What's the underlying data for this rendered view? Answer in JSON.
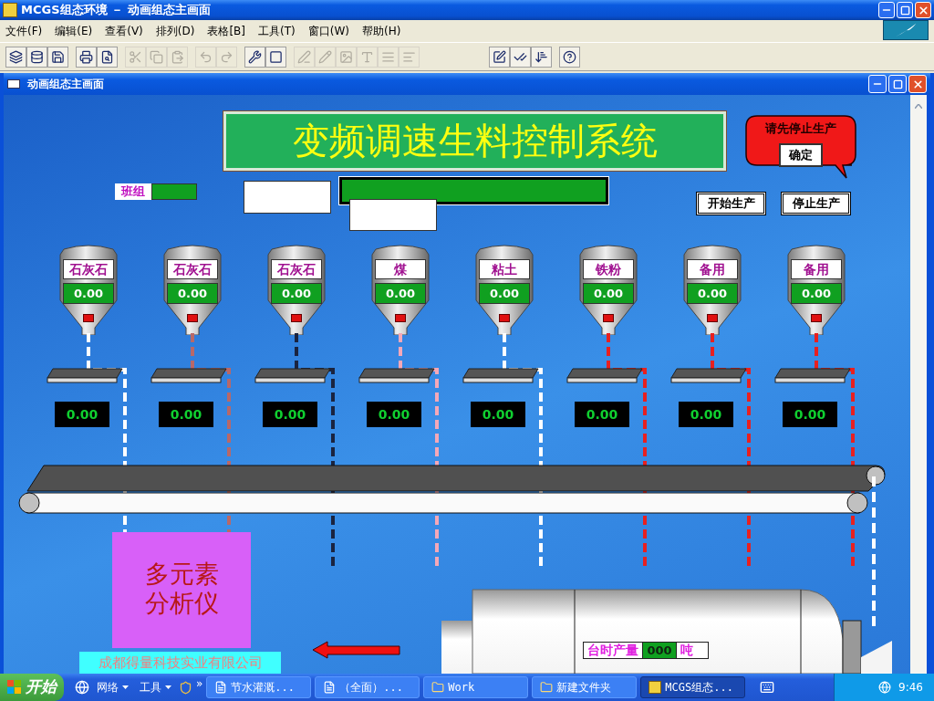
{
  "window": {
    "title": "MCGS组态环境 － 动画组态主画面"
  },
  "menu": [
    "文件(F)",
    "编辑(E)",
    "查看(V)",
    "排列(D)",
    "表格[B]",
    "工具(T)",
    "窗口(W)",
    "帮助(H)"
  ],
  "toolbar": [
    [
      {
        "disabled": false
      },
      {
        "disabled": false
      },
      {
        "disabled": false
      }
    ],
    [
      {
        "disabled": false
      },
      {
        "disabled": false
      }
    ],
    [
      {
        "disabled": true
      },
      {
        "disabled": true
      },
      {
        "disabled": true
      }
    ],
    [
      {
        "disabled": true
      },
      {
        "disabled": true
      }
    ],
    [
      {
        "disabled": false
      },
      {
        "disabled": false
      }
    ],
    [
      {
        "disabled": true
      },
      {
        "disabled": true
      },
      {
        "disabled": true
      },
      {
        "disabled": true
      },
      {
        "disabled": true
      },
      {
        "disabled": true
      }
    ]
  ],
  "toolbar_right": [
    [
      {
        "disabled": false
      },
      {
        "disabled": false
      },
      {
        "disabled": false
      }
    ],
    [
      {
        "disabled": false
      }
    ]
  ],
  "child_window": {
    "title": "动画组态主画面"
  },
  "canvas": {
    "title": "变频调速生料控制系统",
    "alert": {
      "message": "请先停止生产",
      "button": "确定"
    },
    "team": {
      "label": "班组"
    },
    "buttons": [
      "开始生产",
      "停止生产"
    ],
    "hoppers": [
      {
        "label": "石灰石",
        "value": "0.00",
        "weight": "0.00",
        "color": "#ffffff"
      },
      {
        "label": "石灰石",
        "value": "0.00",
        "weight": "0.00",
        "color": "#b86868"
      },
      {
        "label": "石灰石",
        "value": "0.00",
        "weight": "0.00",
        "color": "#1a2440"
      },
      {
        "label": "煤",
        "value": "0.00",
        "weight": "0.00",
        "color": "#f4a8b8"
      },
      {
        "label": "粘土",
        "value": "0.00",
        "weight": "0.00",
        "color": "#ffffff"
      },
      {
        "label": "铁粉",
        "value": "0.00",
        "weight": "0.00",
        "color": "#e82020"
      },
      {
        "label": "备用",
        "value": "0.00",
        "weight": "0.00",
        "color": "#e82020"
      },
      {
        "label": "备用",
        "value": "0.00",
        "weight": "0.00",
        "color": "#e82020"
      }
    ],
    "analyzer": [
      "多元素",
      "分析仪"
    ],
    "company": "成都得量科技实业有限公司",
    "output": {
      "label": "台时产量",
      "value": "000",
      "unit": "吨"
    }
  },
  "taskbar": {
    "start": "开始",
    "quick": [
      "网络",
      "工具"
    ],
    "more": "»",
    "tasks": [
      {
        "label": "节水灌溉...",
        "kind": "doc",
        "selected": false
      },
      {
        "label": "（全面）...",
        "kind": "doc",
        "selected": false
      },
      {
        "label": "Work",
        "kind": "folder",
        "selected": false
      },
      {
        "label": "新建文件夹",
        "kind": "folder",
        "selected": false
      },
      {
        "label": "MCGS组态...",
        "kind": "app",
        "selected": true
      }
    ],
    "clock": "9:46"
  }
}
